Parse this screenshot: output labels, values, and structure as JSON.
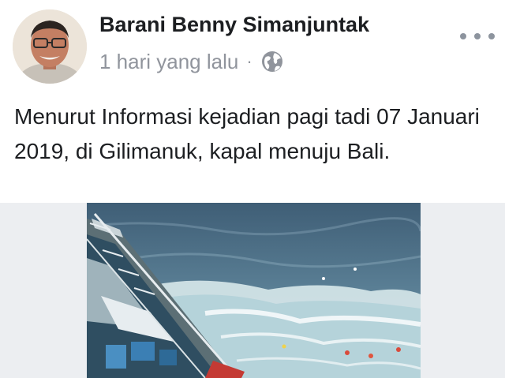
{
  "post": {
    "author": "Barani Benny Simanjuntak",
    "time": "1 hari yang lalu",
    "separator": "·",
    "privacy_icon": "globe-icon",
    "more_icon": "more-options-icon",
    "text": "Menurut Informasi kejadian pagi tadi 07 Januari 2019, di Gilimanuk, kapal menuju Bali."
  },
  "colors": {
    "author_text": "#1c1e21",
    "meta_text": "#90949c",
    "media_background": "#eceef1",
    "sea": "#4d6f86"
  }
}
